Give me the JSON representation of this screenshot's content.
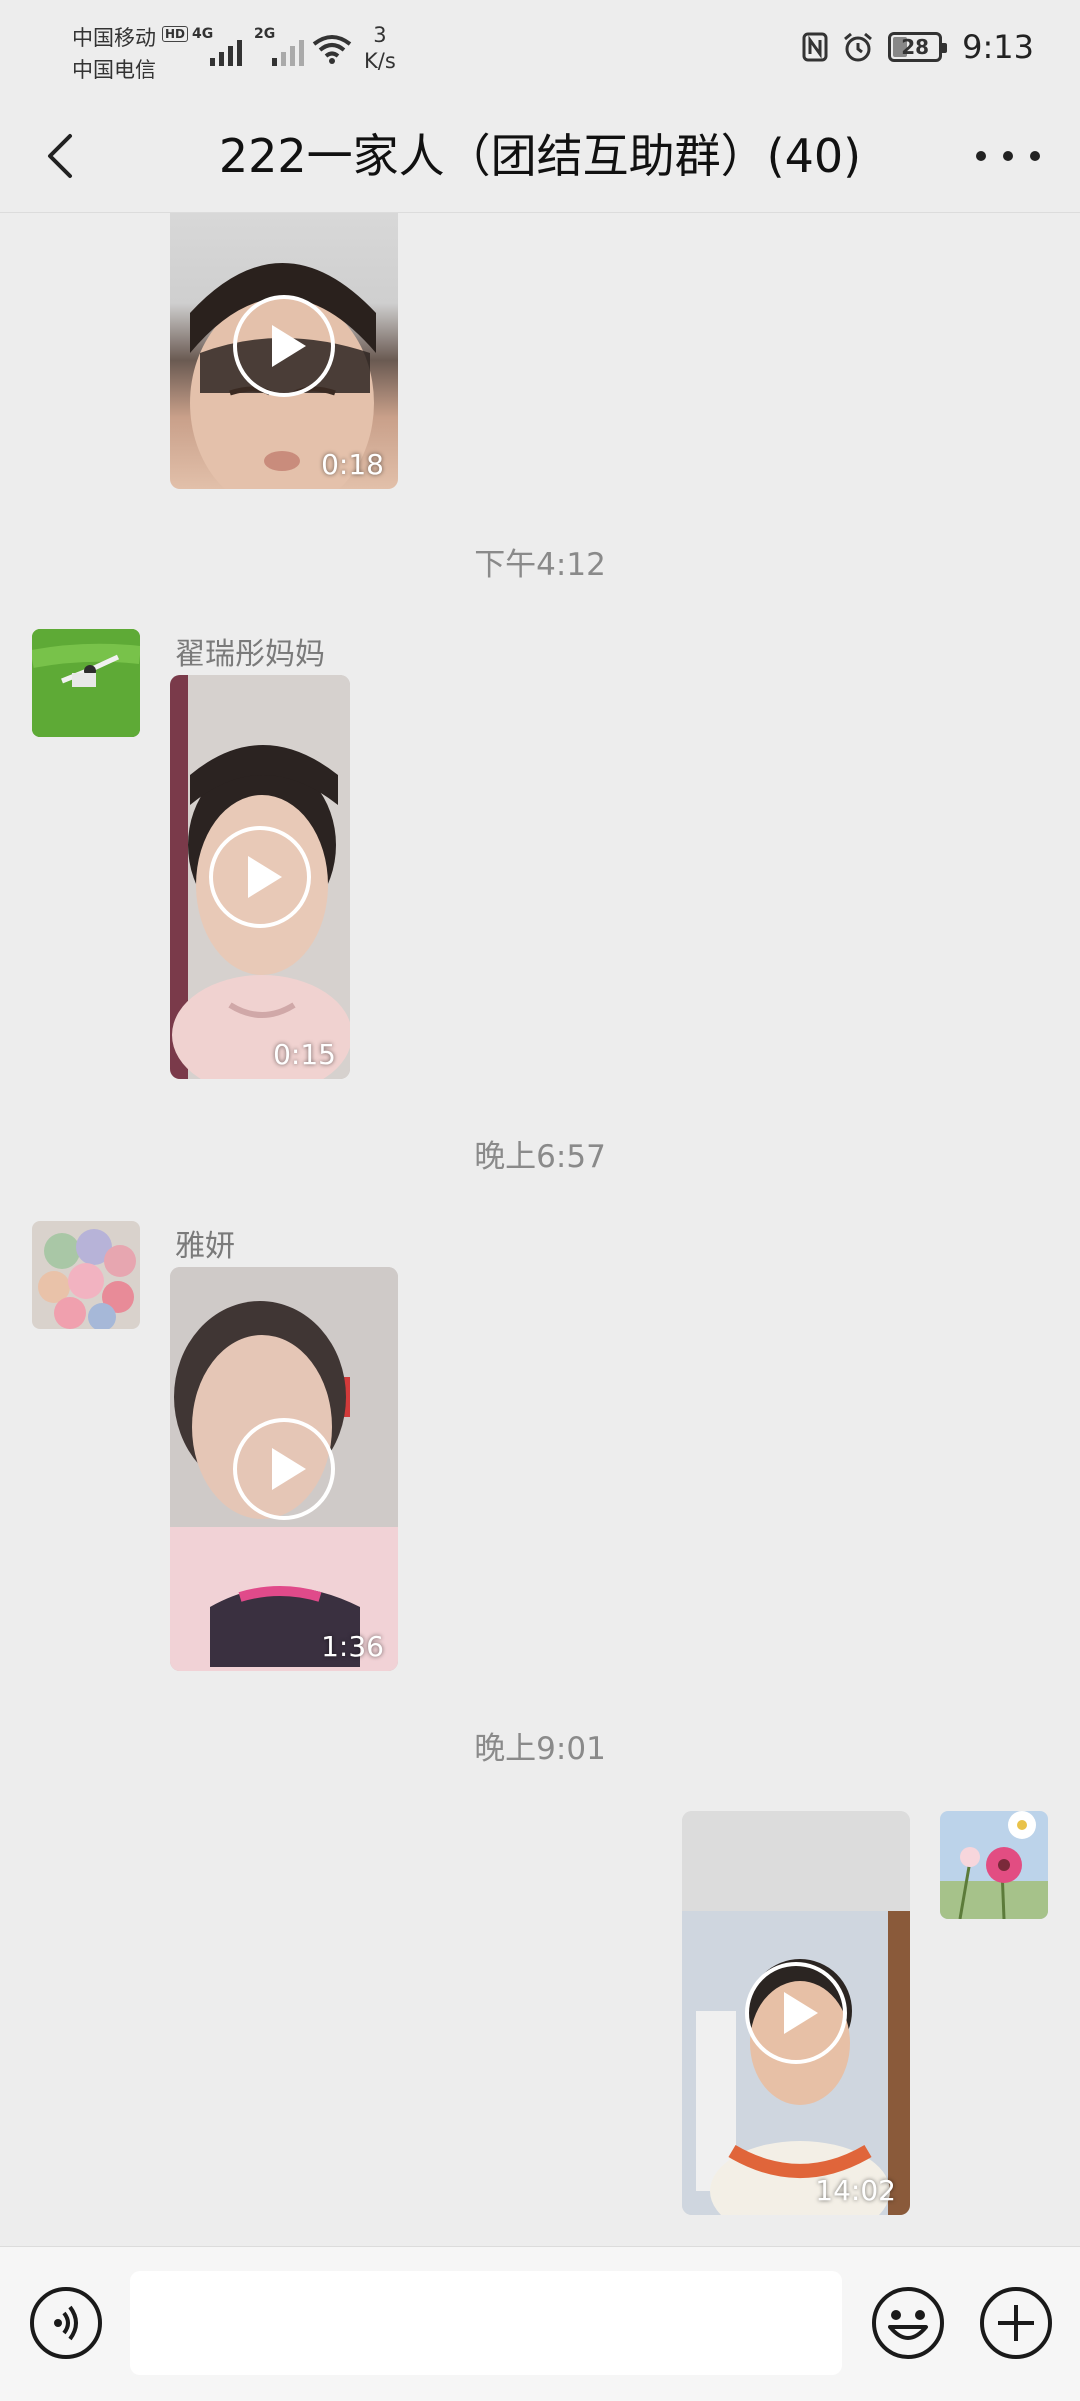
{
  "status_bar": {
    "carrier1": "中国移动",
    "carrier2": "中国电信",
    "hd": "HD",
    "sim1_network": "4G",
    "sim2_network": "2G",
    "net_speed_value": "3",
    "net_speed_unit": "K/s",
    "battery": "28",
    "time": "9:13"
  },
  "header": {
    "title": "222一家人（团结互助群）(40)"
  },
  "messages": [
    {
      "video_duration": "0:18"
    },
    {
      "timestamp": "下午4:12",
      "sender": "翟瑞彤妈妈",
      "video_duration": "0:15"
    },
    {
      "timestamp": "晚上6:57",
      "sender": "雅妍",
      "video_duration": "1:36"
    },
    {
      "timestamp": "晚上9:01",
      "video_duration": "14:02"
    }
  ],
  "input_bar": {
    "text_value": ""
  }
}
